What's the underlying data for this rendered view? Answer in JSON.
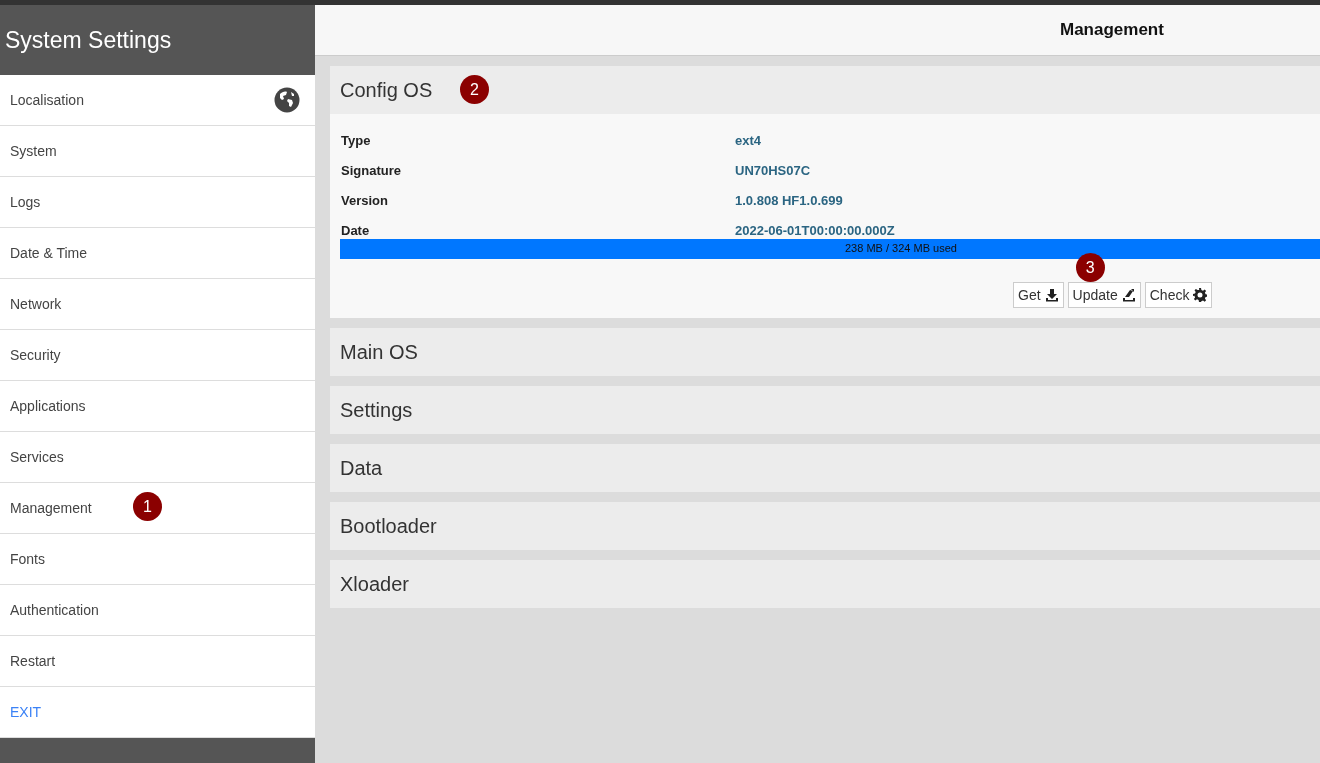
{
  "sidebar": {
    "title": "System Settings",
    "items": [
      {
        "label": "Localisation",
        "selected": false,
        "kind": "item"
      },
      {
        "label": "System",
        "selected": false,
        "kind": "item"
      },
      {
        "label": "Logs",
        "selected": false,
        "kind": "item"
      },
      {
        "label": "Date & Time",
        "selected": false,
        "kind": "item"
      },
      {
        "label": "Network",
        "selected": false,
        "kind": "item"
      },
      {
        "label": "Security",
        "selected": false,
        "kind": "item"
      },
      {
        "label": "Applications",
        "selected": false,
        "kind": "item"
      },
      {
        "label": "Services",
        "selected": false,
        "kind": "item"
      },
      {
        "label": "Management",
        "selected": false,
        "kind": "item",
        "marker": "1"
      },
      {
        "label": "Fonts",
        "selected": false,
        "kind": "item"
      },
      {
        "label": "Authentication",
        "selected": false,
        "kind": "item"
      },
      {
        "label": "Restart",
        "selected": false,
        "kind": "item"
      },
      {
        "label": "EXIT",
        "selected": false,
        "kind": "exit"
      }
    ]
  },
  "main": {
    "title": "Management",
    "panels": [
      {
        "title": "Config OS",
        "expanded": true,
        "marker": "2",
        "details": [
          {
            "label": "Type",
            "value": "ext4"
          },
          {
            "label": "Signature",
            "value": "UN70HS07C"
          },
          {
            "label": "Version",
            "value": "1.0.808 HF1.0.699"
          },
          {
            "label": "Date",
            "value": "2022-06-01T00:00:00.000Z"
          }
        ],
        "usage": {
          "level": 1,
          "reading": "238 MB / 324 MB used"
        },
        "buttons": [
          {
            "label": "Get"
          },
          {
            "label": "Update",
            "marker": "3"
          },
          {
            "label": "Check"
          }
        ]
      },
      {
        "title": "Main OS",
        "expanded": false
      },
      {
        "title": "Settings",
        "expanded": false
      },
      {
        "title": "Data",
        "expanded": false
      },
      {
        "title": "Bootloader",
        "expanded": false
      },
      {
        "title": "Xloader",
        "expanded": false
      }
    ]
  }
}
